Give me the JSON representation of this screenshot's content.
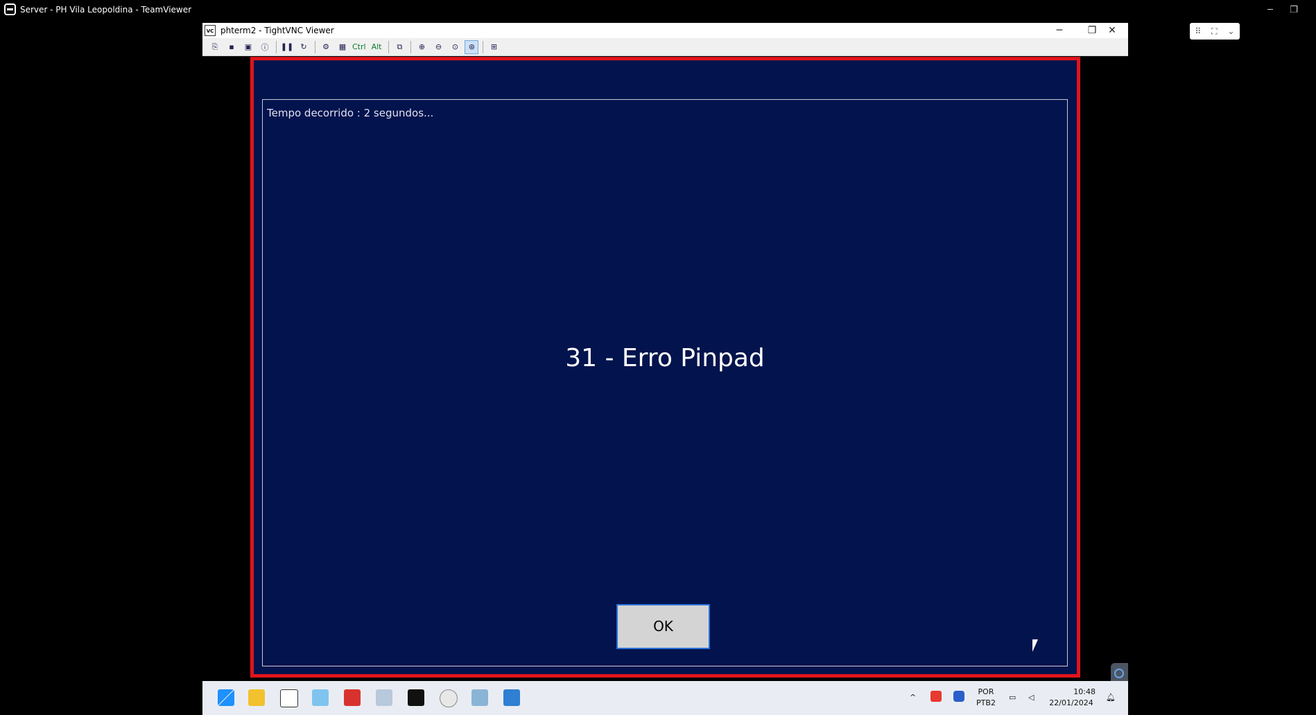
{
  "teamviewer": {
    "title": "Server - PH Vila Leopoldina - TeamViewer",
    "minimize": "─",
    "restore": "❐"
  },
  "vnc_window": {
    "title": "phterm2 - TightVNC Viewer",
    "minimize": "─",
    "maximize": "❐",
    "close": "✕",
    "toolbar": {
      "ctrl_label": "Ctrl",
      "alt_label": "Alt"
    }
  },
  "dialog": {
    "elapsed_text": "Tempo decorrido : 2 segundos...",
    "message": "31 - Erro Pinpad",
    "ok_label": "OK",
    "colors": {
      "background": "#03134d",
      "frame": "#e0141c"
    }
  },
  "taskbar": {
    "language_line1": "POR",
    "language_line2": "PTB2",
    "time": "10:48",
    "date": "22/01/2024"
  }
}
